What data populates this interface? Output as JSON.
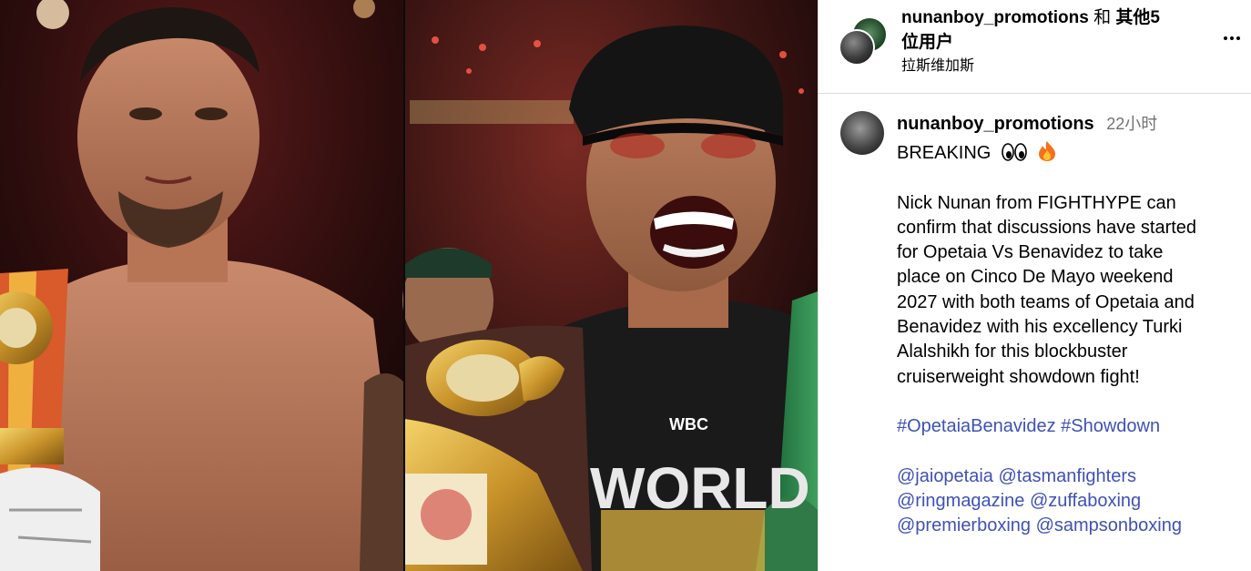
{
  "header": {
    "owner": "nunanboy_promotions",
    "joiner": "和",
    "others": "其他5",
    "others_line2": "位用户",
    "location": "拉斯维加斯"
  },
  "caption": {
    "username": "nunanboy_promotions",
    "time": "22小时",
    "headline": "BREAKING",
    "body_lines": [
      "Nick Nunan from FIGHTHYPE can",
      "confirm that discussions have started",
      "for Opetaia Vs Benavidez to take",
      "place on Cinco De Mayo weekend",
      "2027 with both teams of Opetaia and",
      "Benavidez with his excellency Turki",
      "Alalshikh for this blockbuster",
      "cruiserweight showdown fight!"
    ],
    "hashtags": [
      "#OpetaiaBenavidez",
      "#Showdown"
    ],
    "mentions": [
      [
        "@jaiopetaia",
        "@tasmanfighters"
      ],
      [
        "@ringmagazine",
        "@zuffaboxing"
      ],
      [
        "@premierboxing",
        "@sampsonboxing"
      ]
    ]
  },
  "photo": {
    "belt_text": "WBC",
    "belt_banner": "WORLD"
  },
  "icons": {
    "more": "more-horizontal-icon",
    "eyes": "eyes-emoji",
    "fire": "fire-emoji"
  },
  "colors": {
    "link": "#3f51b5",
    "timestamp": "#737373",
    "divider": "#dbdbdb"
  }
}
